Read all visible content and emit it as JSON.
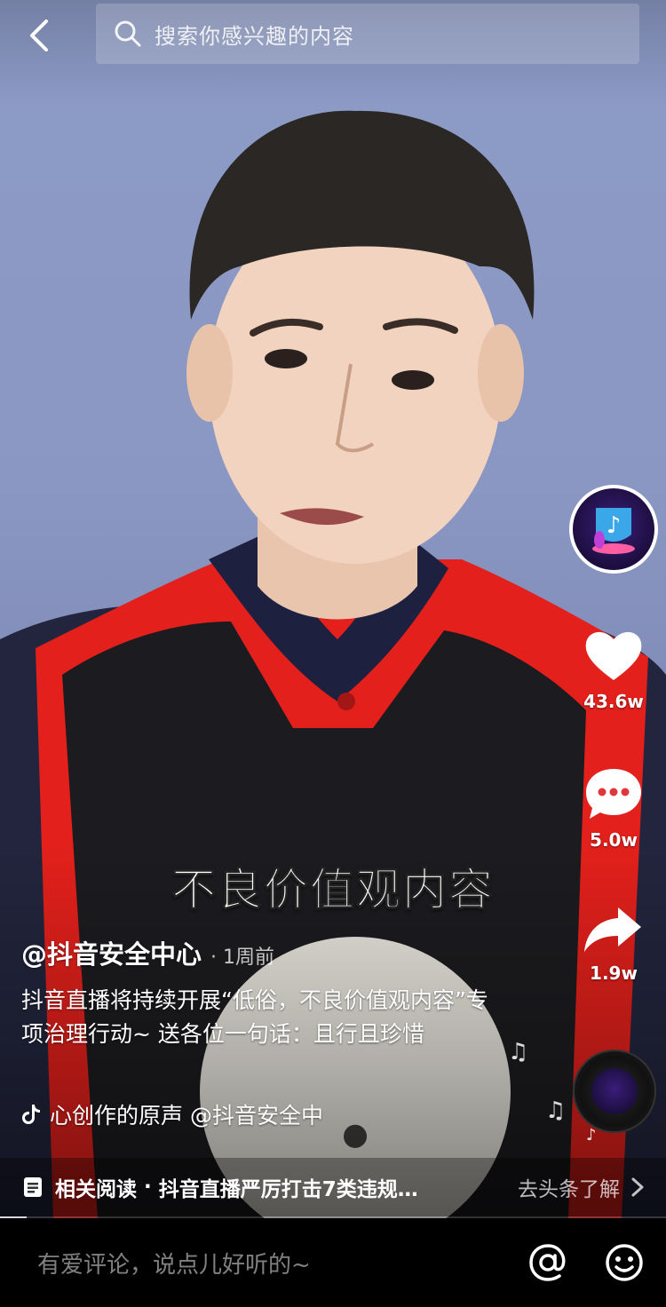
{
  "top_bar": {
    "back_icon": "chevron-left-icon",
    "search_icon": "search-icon",
    "search_placeholder": "搜索你感兴趣的内容"
  },
  "video": {
    "subtitle": "不良价值观内容"
  },
  "right_rail": {
    "avatar_icon": "douyin-avatar",
    "like_count": "43.6w",
    "comment_count": "5.0w",
    "share_count": "1.9w",
    "music_disc_icon": "music-disc-icon"
  },
  "post": {
    "author": "@抖音安全中心",
    "time": "· 1周前",
    "description": "抖音直播将持续开展“低俗，不良价值观内容”专项治理行动~ 送各位一句话：且行且珍惜",
    "music": "心创作的原声    @抖音安全中"
  },
  "related": {
    "label": "相关阅读",
    "separator": "·",
    "title": "抖音直播严厉打击7类违规…",
    "link": "去头条了解"
  },
  "playback": {
    "progress": 0.04
  },
  "comment_bar": {
    "placeholder": "有爱评论，说点儿好听的~"
  },
  "colors": {
    "background_blue": "#8b97c3",
    "robe_red": "#e3201b",
    "vest_black": "#1c1b1f"
  }
}
